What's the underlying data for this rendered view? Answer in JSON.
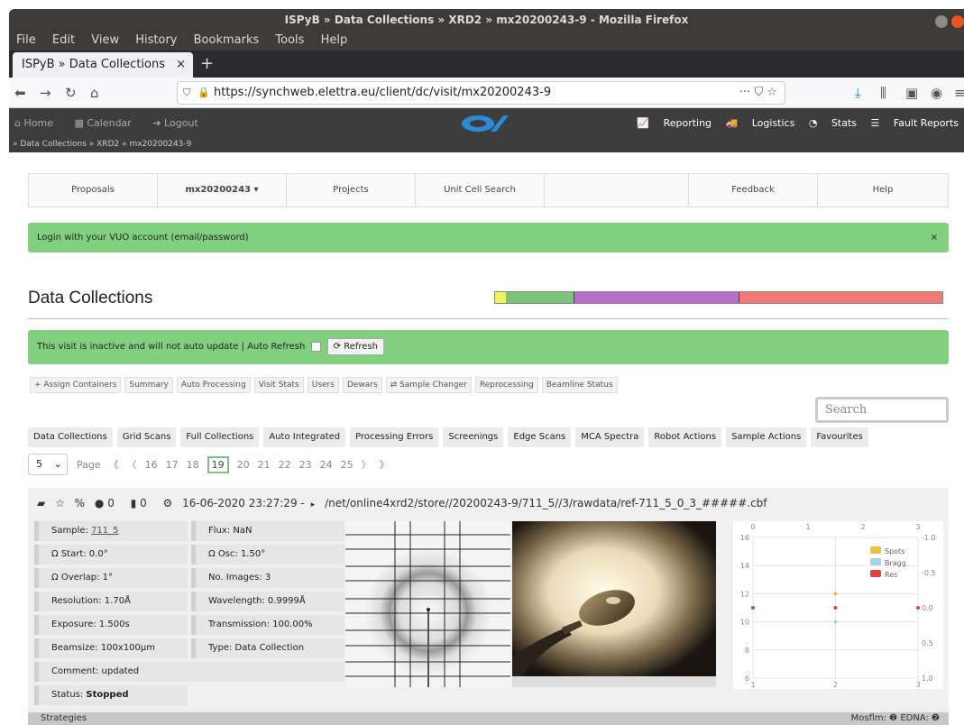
{
  "window": {
    "title": "ISPyB » Data Collections » XRD2 » mx20200243-9 - Mozilla Firefox",
    "menu": [
      "File",
      "Edit",
      "View",
      "History",
      "Bookmarks",
      "Tools",
      "Help"
    ]
  },
  "browser": {
    "tab_title": "ISPyB » Data Collections",
    "tab_close": "×",
    "new_tab": "+",
    "url": "https://synchweb.elettra.eu/client/dc/visit/mx20200243-9",
    "url_actions": "··· ⛉ ☆"
  },
  "appbar": {
    "left": [
      "Home",
      "Calendar",
      "Logout"
    ],
    "right": [
      "Reporting",
      "Logistics",
      "Stats",
      "Fault Reports"
    ],
    "breadcrumb": "» Data Collections » XRD2 » mx20200243-9"
  },
  "mainmenu": [
    "Proposals",
    "mx20200243 ▾",
    "Projects",
    "Unit Cell Search",
    "",
    "Feedback",
    "Help"
  ],
  "login_message": "Login with your VUO account (email/password)",
  "login_close": "×",
  "page_title": "Data Collections",
  "progress_colors": [
    "#f6f05a",
    "#7cc47a",
    "#b46fc7",
    "#f07878"
  ],
  "inactive_message": "This visit is inactive and will not auto update | Auto Refresh",
  "refresh_label": "⟳ Refresh",
  "actions": [
    "+ Assign Containers",
    "Summary",
    "Auto Processing",
    "Visit Stats",
    "Users",
    "Dewars",
    "⇄ Sample Changer",
    "Reprocessing",
    "Beamline Status"
  ],
  "search_placeholder": "Search",
  "subtabs": [
    "Data Collections",
    "Grid Scans",
    "Full Collections",
    "Auto Integrated",
    "Processing Errors",
    "Screenings",
    "Edge Scans",
    "MCA Spectra",
    "Robot Actions",
    "Sample Actions",
    "Favourites"
  ],
  "pager": {
    "per_page": "5",
    "label": "Page",
    "first": "《",
    "prev": "〈",
    "pages": [
      "16",
      "17",
      "18",
      "19",
      "20",
      "21",
      "22",
      "23",
      "24",
      "25"
    ],
    "current": "19",
    "next": "〉",
    "last": "》"
  },
  "dc": {
    "comments": "0",
    "attachments": "0",
    "header": "16-06-2020 23:27:29 -",
    "path": "/net/online4xrd2/store//20200243-9/711_5//3/rawdata/ref-711_5_0_3_#####.cbf",
    "sample_label": "Sample:",
    "sample_value": "711_5",
    "flux": "Flux: NaN",
    "omega_start": "Ω Start: 0.0°",
    "omega_osc": "Ω Osc: 1.50°",
    "omega_overlap": "Ω Overlap: 1°",
    "no_images": "No. Images: 3",
    "resolution": "Resolution: 1.70Å",
    "wavelength": "Wavelength: 0.9999Å",
    "exposure": "Exposure: 1.500s",
    "transmission": "Transmission: 100.00%",
    "beamsize": "Beamsize: 100x100μm",
    "type": "Type: Data Collection",
    "comment": "Comment: updated",
    "status_label": "Status:",
    "status_value": "Stopped"
  },
  "chart_data": {
    "type": "scatter",
    "x_ticks_top": [
      "0",
      "1",
      "2",
      "3"
    ],
    "x_ticks_bottom": [
      "1",
      "2",
      "3"
    ],
    "y_ticks_left": [
      "16",
      "14",
      "12",
      "10",
      "8",
      "6"
    ],
    "y_ticks_right": [
      "-1.0",
      "-0.5",
      "0.0",
      "0.5",
      "1.0"
    ],
    "legend": [
      {
        "name": "Spots",
        "color": "#f0c040"
      },
      {
        "name": "Bragg",
        "color": "#a8d0f0"
      },
      {
        "name": "Res",
        "color": "#e04040"
      }
    ],
    "series": [
      {
        "name": "Res",
        "x": [
          1,
          2,
          3
        ],
        "y": [
          0,
          0,
          0
        ],
        "axis": "right"
      },
      {
        "name": "Spots",
        "x": [
          2
        ],
        "y": [
          12
        ],
        "axis": "left"
      },
      {
        "name": "Bragg",
        "x": [
          2
        ],
        "y": [
          10
        ],
        "axis": "left"
      }
    ]
  },
  "strategies_label": "Strategies",
  "strategies_right": "Mosflm: ❷ EDNA: ❷"
}
